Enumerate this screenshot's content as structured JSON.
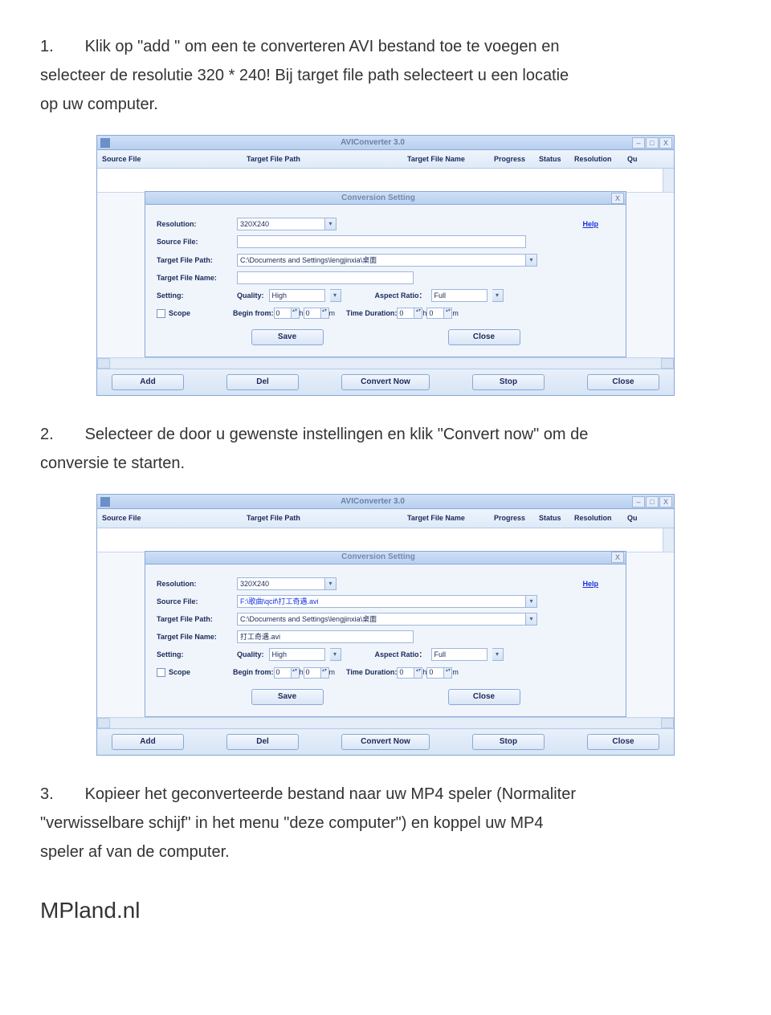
{
  "step1": {
    "num": "1.",
    "text_a": "Klik op \"add \" om een te converteren AVI bestand toe te voegen en",
    "text_b": "selecteer de resolutie 320 * 240! Bij target file path selecteert u een locatie",
    "text_c": "op uw computer."
  },
  "step2": {
    "num": "2.",
    "text_a": "Selecteer de door u gewenste instellingen en klik \"Convert now\" om de",
    "text_b": "conversie te starten."
  },
  "step3": {
    "num": "3.",
    "text_a": "Kopieer het geconverteerde bestand naar uw MP4 speler (Normaliter",
    "text_b": "\"verwisselbare schijf\" in het menu \"deze computer\") en koppel uw MP4",
    "text_c": "speler af van de computer."
  },
  "footer": "MPland.nl",
  "app": {
    "title": "AVIConverter 3.0",
    "columns": {
      "c1": "Source File",
      "c2": "Target File Path",
      "c3": "Target File Name",
      "c4": "Progress",
      "c5": "Status",
      "c6": "Resolution",
      "c7": "Qu"
    },
    "dialog": {
      "title": "Conversion Setting",
      "labels": {
        "resolution": "Resolution:",
        "source_file": "Source File:",
        "target_path": "Target File Path:",
        "target_name": "Target File Name:",
        "setting": "Setting:",
        "quality": "Quality:",
        "aspect": "Aspect Ratio：",
        "scope": "Scope",
        "begin_from": "Begin from:",
        "time_duration": "Time Duration:",
        "h": "h",
        "m": "m",
        "help": "Help"
      },
      "values_a": {
        "resolution": "320X240",
        "source_file": "",
        "target_path": "C:\\Documents and Settings\\lengjinxia\\桌面",
        "target_name": "",
        "quality": "High",
        "aspect": "Full",
        "bf_h": "0",
        "bf_m": "0",
        "td_h": "0",
        "td_m": "0"
      },
      "values_b": {
        "resolution": "320X240",
        "source_file": "F:\\歌曲\\qcif\\打工奇遇.avi",
        "target_path": "C:\\Documents and Settings\\lengjinxia\\桌面",
        "target_name": "打工奇遇.avi",
        "quality": "High",
        "aspect": "Full",
        "bf_h": "0",
        "bf_m": "0",
        "td_h": "0",
        "td_m": "0"
      },
      "buttons": {
        "save": "Save",
        "close": "Close"
      }
    },
    "toolbar": {
      "add": "Add",
      "del": "Del",
      "convert": "Convert Now",
      "stop": "Stop",
      "close": "Close"
    },
    "win": {
      "min": "–",
      "max": "□",
      "close": "X"
    }
  }
}
